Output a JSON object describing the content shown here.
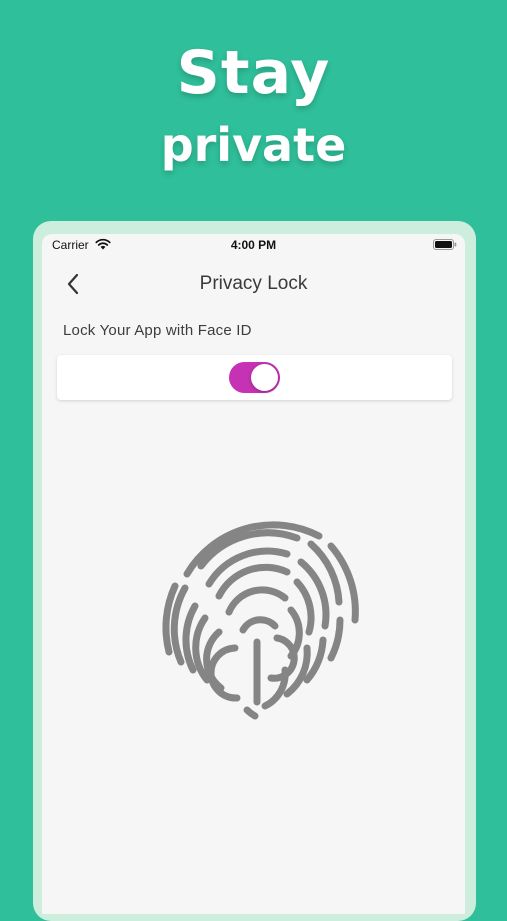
{
  "headline": {
    "line1": "Stay",
    "line2": "private"
  },
  "status_bar": {
    "carrier": "Carrier",
    "time": "4:00 PM"
  },
  "nav": {
    "title": "Privacy Lock"
  },
  "settings": {
    "face_id_label": "Lock Your App with Face ID",
    "face_id_enabled": true
  },
  "colors": {
    "background": "#2fbf9a",
    "toggle_on": "#c532b4",
    "fingerprint": "#858585"
  },
  "icons": {
    "back": "chevron-left-icon",
    "wifi": "wifi-icon",
    "battery": "battery-icon",
    "fingerprint": "fingerprint-icon"
  }
}
